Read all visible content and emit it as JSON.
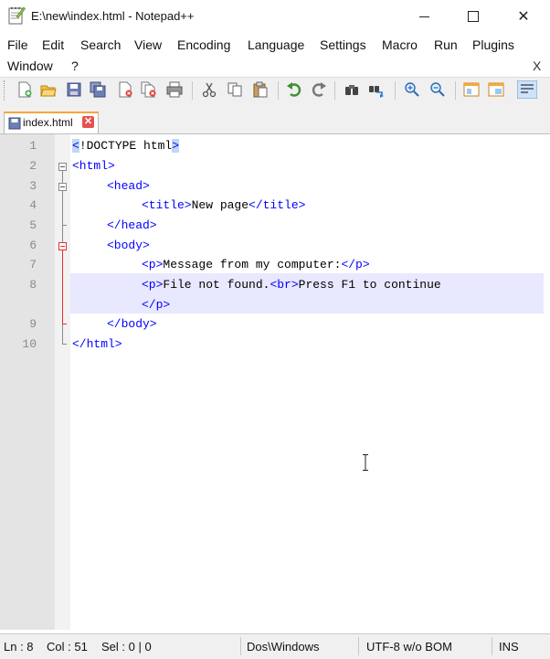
{
  "window": {
    "title": "E:\\new\\index.html - Notepad++",
    "minimize_icon": "minimize-icon",
    "maximize_icon": "maximize-icon",
    "close_glyph": "✕"
  },
  "menu": {
    "items": [
      "File",
      "Edit",
      "Search",
      "View",
      "Encoding",
      "Language",
      "Settings",
      "Macro",
      "Run",
      "Plugins",
      "Window",
      "?"
    ],
    "close_label": "X"
  },
  "toolbar": {
    "icons": [
      "new-file-icon",
      "open-file-icon",
      "save-icon",
      "save-all-icon",
      "close-icon",
      "close-all-icon",
      "print-icon",
      "cut-icon",
      "copy-icon",
      "paste-icon",
      "undo-icon",
      "redo-icon",
      "find-icon",
      "replace-icon",
      "zoom-in-icon",
      "zoom-out-icon",
      "sync-vertical-icon",
      "sync-horizontal-icon",
      "word-wrap-icon"
    ]
  },
  "tabs": [
    {
      "label": "index.html",
      "close_glyph": "✕"
    }
  ],
  "editor": {
    "line_numbers": [
      "1",
      "2",
      "3",
      "4",
      "5",
      "6",
      "7",
      "8",
      "9",
      "10"
    ],
    "lines": {
      "l1_open": "<",
      "l1_doctype": "!DOCTYPE html",
      "l1_close": ">",
      "l2": "<html>",
      "l3": "<head>",
      "l4_open": "<title>",
      "l4_text": "New page",
      "l4_close": "</title>",
      "l5": "</head>",
      "l6": "<body>",
      "l7_open": "<p>",
      "l7_text": "Message from my computer:",
      "l7_close": "</p>",
      "l8_open": "<p>",
      "l8_text1": "File not found.",
      "l8_br": "<br>",
      "l8_text2": "Press F1 to continue",
      "l8_wrap": "</p>",
      "l9": "</body>",
      "l10": "</html>"
    }
  },
  "statusbar": {
    "ln": "Ln : 8",
    "col": "Col : 51",
    "sel": "Sel : 0 | 0",
    "eol": "Dos\\Windows",
    "encoding": "UTF-8 w/o BOM",
    "mode": "INS"
  },
  "colors": {
    "tag": "#0000ff",
    "text": "#000000",
    "current_line": "#e8e8ff",
    "fold_active": "#e03030"
  }
}
